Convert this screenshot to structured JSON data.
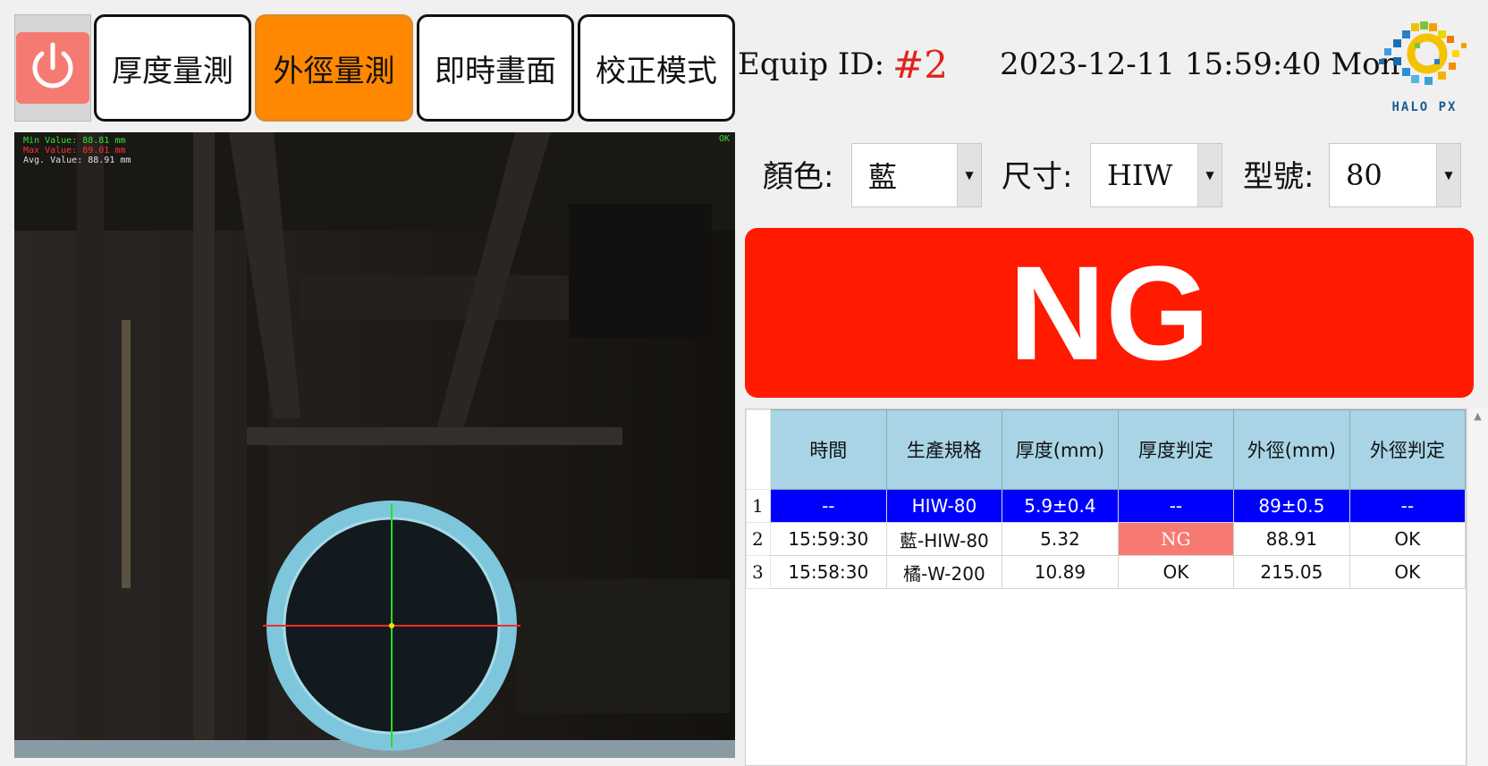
{
  "nav": {
    "power_icon": "power-icon",
    "tabs": [
      {
        "label": "厚度量測",
        "active": false
      },
      {
        "label": "外徑量測",
        "active": true
      },
      {
        "label": "即時畫面",
        "active": false
      },
      {
        "label": "校正模式",
        "active": false
      }
    ]
  },
  "header": {
    "equip_label": "Equip ID:",
    "equip_id": "#2",
    "datetime": "2023-12-11 15:59:40 Mon.",
    "logo_text": "HALO PX"
  },
  "camera": {
    "min_value": "Min Value: 88.81 mm",
    "max_value": "Max Value: 89.01 mm",
    "avg_value": "Avg. Value: 88.91 mm",
    "status": "OK"
  },
  "selectors": {
    "color": {
      "label": "顏色:",
      "value": "藍"
    },
    "size": {
      "label": "尺寸:",
      "value": "HIW"
    },
    "model": {
      "label": "型號:",
      "value": "80"
    }
  },
  "result": "NG",
  "grid": {
    "headers": [
      "時間",
      "生產規格",
      "厚度(mm)",
      "厚度判定",
      "外徑(mm)",
      "外徑判定"
    ],
    "rows": [
      {
        "num": "1",
        "cells": [
          "--",
          "HIW-80",
          "5.9±0.4",
          "--",
          "89±0.5",
          "--"
        ]
      },
      {
        "num": "2",
        "cells": [
          "15:59:30",
          "藍-HIW-80",
          "5.32",
          "NG",
          "88.91",
          "OK"
        ]
      },
      {
        "num": "3",
        "cells": [
          "15:58:30",
          "橘-W-200",
          "10.89",
          "OK",
          "215.05",
          "OK"
        ]
      }
    ]
  },
  "colors": {
    "active_tab": "#ff8800",
    "ng_banner": "#ff1a00",
    "selected_row": "#0000ff",
    "header_cell": "#a8d4e6"
  }
}
